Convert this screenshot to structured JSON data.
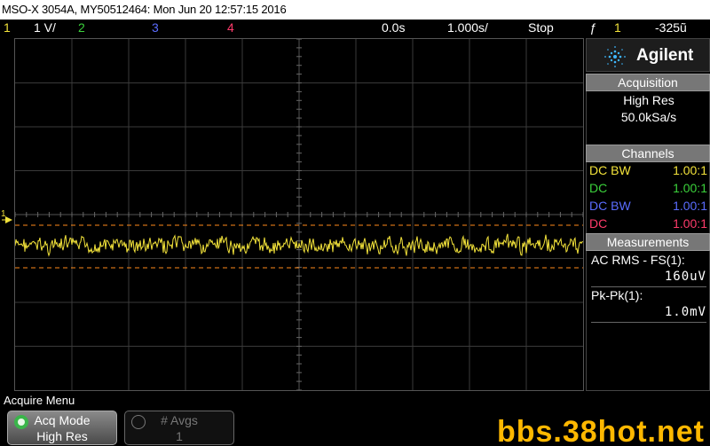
{
  "title_bar": "MSO-X 3054A, MY50512464: Mon Jun 20 12:57:15 2016",
  "status": {
    "ch1_label": "1",
    "ch1_scale": "1 V/",
    "ch2_label": "2",
    "ch3_label": "3",
    "ch4_label": "4",
    "time_delay": "0.0s",
    "time_scale": "1.000s/",
    "run_state": "Stop",
    "trigger_icon": "ƒ",
    "trigger_source": "1",
    "trigger_level": "-325ũ"
  },
  "colors": {
    "ch1": "#f2e23a",
    "ch2": "#3bd13b",
    "ch3": "#5a6cff",
    "ch4": "#ff3b6b",
    "cursor": "#ff8a1a"
  },
  "sidebar": {
    "brand": "Agilent",
    "acquisition": {
      "header": "Acquisition",
      "mode": "High Res",
      "rate": "50.0kSa/s"
    },
    "channels": {
      "header": "Channels",
      "rows": [
        {
          "coupling": "DC BW",
          "probe": "1.00:1"
        },
        {
          "coupling": "DC",
          "probe": "1.00:1"
        },
        {
          "coupling": "DC BW",
          "probe": "1.00:1"
        },
        {
          "coupling": "DC",
          "probe": "1.00:1"
        }
      ]
    },
    "measurements": {
      "header": "Measurements",
      "items": [
        {
          "label": "AC RMS - FS(1):",
          "value": "160uV"
        },
        {
          "label": "Pk-Pk(1):",
          "value": "1.0mV"
        }
      ]
    }
  },
  "menu": {
    "title": "Acquire Menu",
    "softkeys": [
      {
        "line1": "Acq Mode",
        "line2": "High Res",
        "active": true
      },
      {
        "line1": "# Avgs",
        "line2": "1",
        "active": false
      }
    ]
  },
  "watermark": "bbs.38hot.net"
}
